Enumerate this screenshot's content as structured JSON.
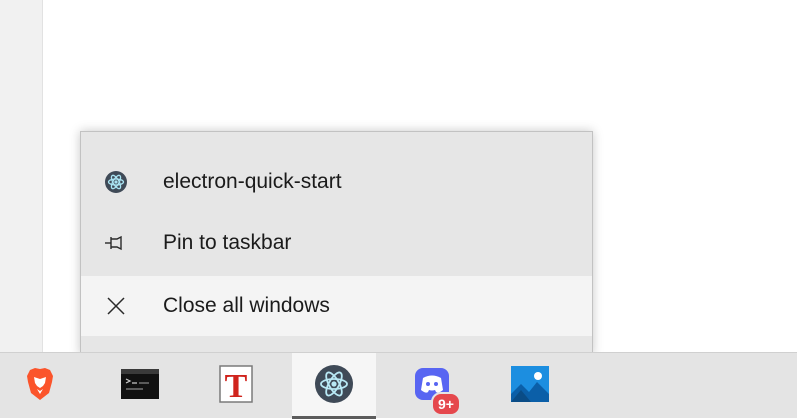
{
  "jump_list": {
    "items": [
      {
        "label": "electron-quick-start",
        "icon": "electron-icon"
      },
      {
        "label": "Pin to taskbar",
        "icon": "pin-icon"
      },
      {
        "label": "Close all windows",
        "icon": "close-icon"
      }
    ]
  },
  "taskbar": {
    "apps": [
      {
        "icon": "brave-browser-icon"
      },
      {
        "icon": "terminal-icon"
      },
      {
        "icon": "typora-icon",
        "glyph": "T"
      },
      {
        "icon": "electron-icon",
        "active": true
      },
      {
        "icon": "discord-icon",
        "badge": "9+"
      },
      {
        "icon": "photos-icon"
      }
    ]
  },
  "colors": {
    "menu_bg": "#e6e6e6",
    "menu_hover": "#f4f4f4",
    "taskbar_bg": "#e4e4e4",
    "brave_orange": "#fb542b",
    "typora_red": "#d0241d",
    "discord_blurple": "#5865f2",
    "badge_red": "#e5484d",
    "photos_blue": "#1c8ee0"
  }
}
